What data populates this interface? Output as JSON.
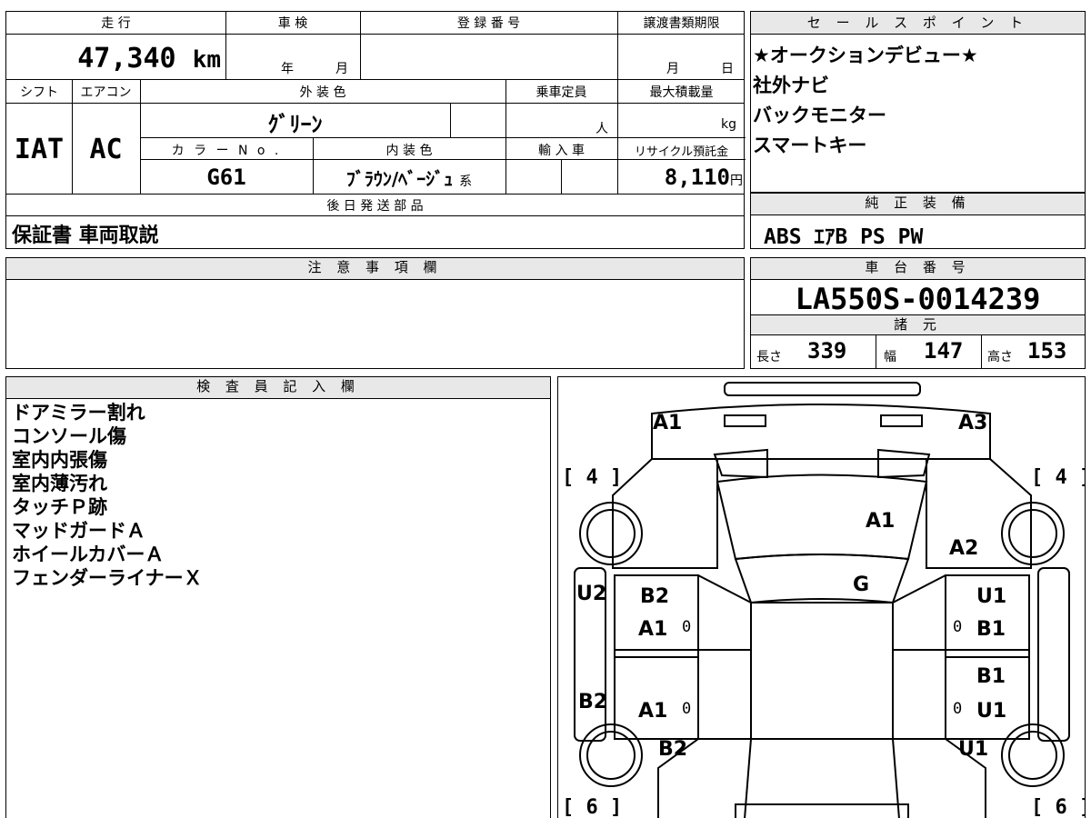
{
  "left_table": {
    "labels": {
      "mileage": "走 行",
      "shaken": "車 検",
      "reg_no": "登 録 番 号",
      "transfer_deadline": "譲渡書類期限",
      "shift": "シフト",
      "aircon": "エアコン",
      "exterior_color": "外 装 色",
      "capacity": "乗車定員",
      "max_load": "最大積載量",
      "color_no": "カ ラ ー N o .",
      "interior_color": "内 装 色",
      "import": "輸 入 車",
      "recycle_fee": "リサイクル預託金",
      "later_parts": "後 日 発 送 部 品"
    },
    "values": {
      "mileage": "47,340",
      "mileage_unit": "km",
      "shaken_year": "年",
      "shaken_month": "月",
      "deadline_month": "月",
      "deadline_day": "日",
      "shift": "IAT",
      "aircon": "AC",
      "exterior_color": "ｸﾞﾘｰﾝ",
      "capacity_unit": "人",
      "load_unit": "kg",
      "color_no": "G61",
      "interior_color": "ﾌﾞﾗｳﾝ/ﾍﾞｰｼﾞｭ",
      "interior_suffix": "系",
      "recycle_fee": "8,110",
      "recycle_unit": "円",
      "later_parts": "保証書 車両取説"
    }
  },
  "sales_point": {
    "header": "セ ー ル ス ポ イ ン ト",
    "items": [
      "★オークションデビュー★",
      "社外ナビ",
      "バックモニター",
      "スマートキー"
    ]
  },
  "standard_equipment": {
    "header": "純 正 装 備",
    "value": "ABS ｴｱB PS PW"
  },
  "notes": {
    "header": "注 意 事 項 欄"
  },
  "chassis": {
    "header": "車 台 番 号",
    "value": "LA550S-0014239",
    "spec_header": "諸 元",
    "length_label": "長さ",
    "length": "339",
    "width_label": "幅",
    "width": "147",
    "height_label": "高さ",
    "height": "153"
  },
  "inspector": {
    "header": "検 査 員 記 入 欄",
    "items": [
      "ドアミラー割れ",
      "コンソール傷",
      "室内内張傷",
      "室内薄汚れ",
      "タッチＰ跡",
      "マッドガードＡ",
      "ホイールカバーＡ",
      "フェンダーライナーＸ"
    ]
  },
  "diagram": {
    "marks": {
      "a1_front_left": "A1",
      "a3_front_right": "A3",
      "a1_hood": "A1",
      "a2_fender_right": "A2",
      "g_windshield": "G",
      "u2_left": "U2",
      "b2_left_front_door": "B2",
      "a1_left_front_door": "A1",
      "b2_left_side": "B2",
      "a1_left_rear_door": "A1",
      "b2_left_rear": "B2",
      "u1_right": "U1",
      "b1_right_front_door": "B1",
      "b1_right_rear_door": "B1",
      "u1_right_rear_door": "U1",
      "u1_right_rear": "U1"
    },
    "tires": {
      "front_left": "[ 4 ]",
      "front_right": "[ 4 ]",
      "rear_left": "[ 6 ]",
      "rear_right": "[ 6 ]"
    },
    "door_zero": "0"
  }
}
